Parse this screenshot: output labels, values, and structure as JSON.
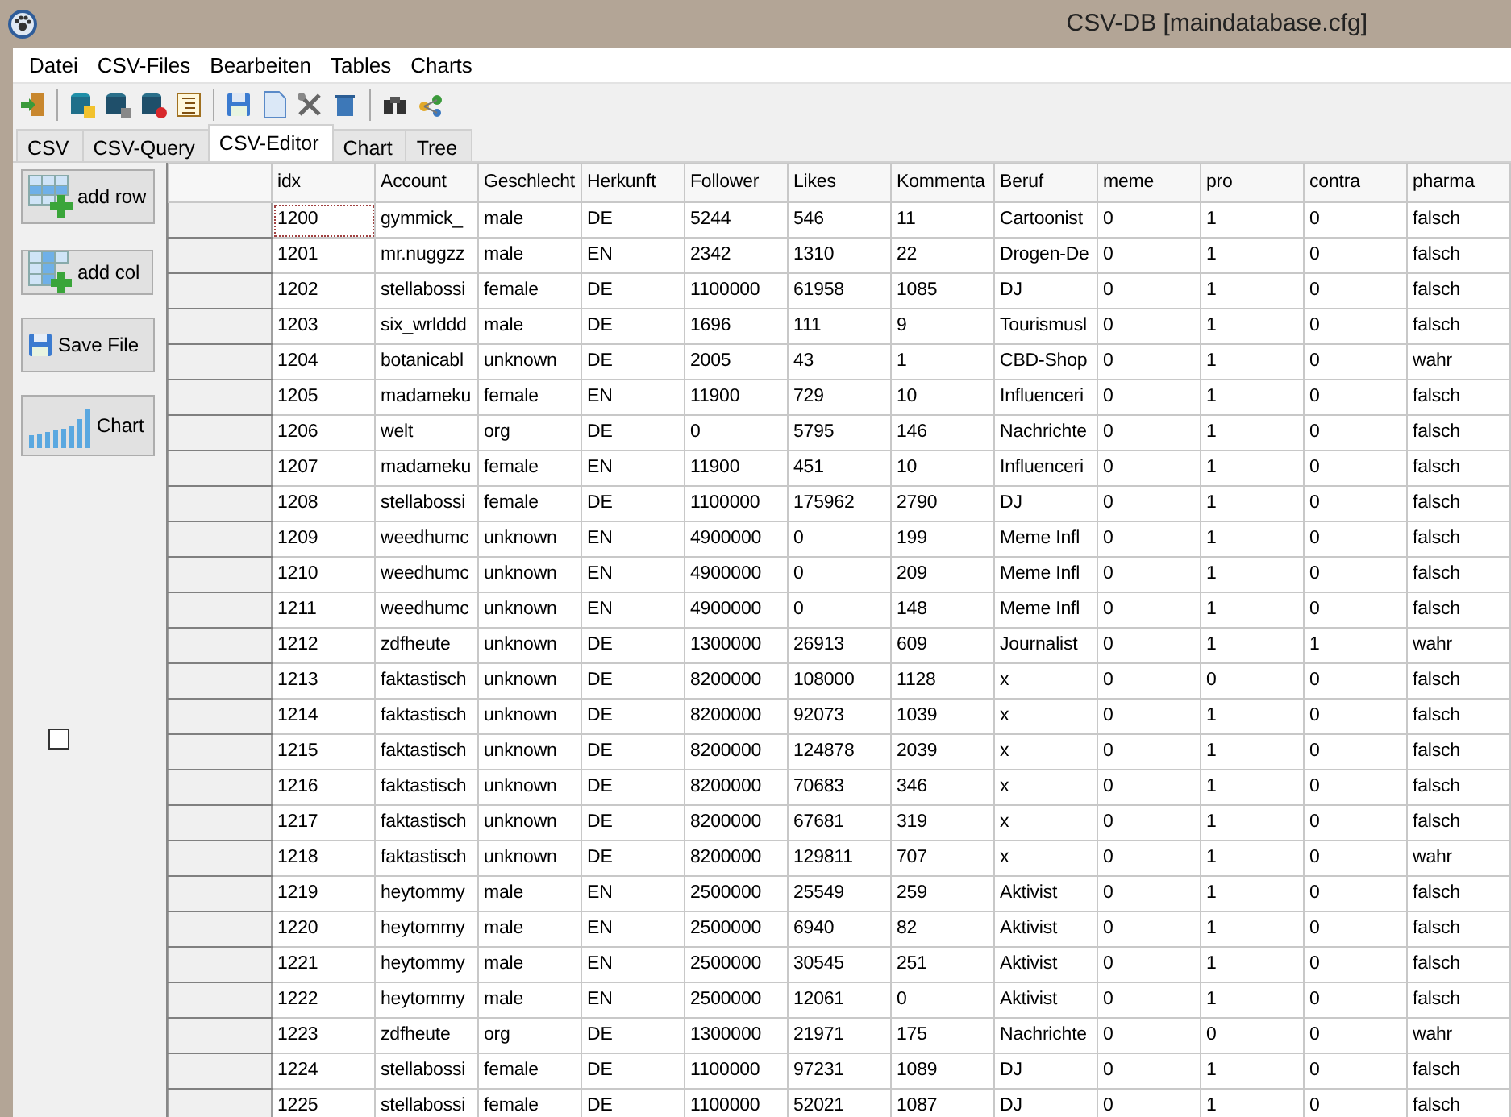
{
  "window": {
    "title": "CSV-DB [maindatabase.cfg]"
  },
  "menu": [
    "Datei",
    "CSV-Files",
    "Bearbeiten",
    "Tables",
    "Charts"
  ],
  "tabs": [
    {
      "label": "CSV",
      "selected": false
    },
    {
      "label": "CSV-Query",
      "selected": false
    },
    {
      "label": "CSV-Editor",
      "selected": true
    },
    {
      "label": "Chart",
      "selected": false
    },
    {
      "label": "Tree",
      "selected": false
    }
  ],
  "side_buttons": [
    {
      "label": "add row",
      "kind": "addrow"
    },
    {
      "label": "add col",
      "kind": "addcol"
    },
    {
      "label": "Save File",
      "kind": "save"
    },
    {
      "label": "Chart",
      "kind": "chart"
    }
  ],
  "checkbox": {
    "checked": false
  },
  "table": {
    "columns": [
      "idx",
      "Account",
      "Geschlecht",
      "Herkunft",
      "Follower",
      "Likes",
      "Kommenta",
      "Beruf",
      "meme",
      "pro",
      "contra",
      "pharma"
    ],
    "rows": [
      {
        "focused": true,
        "cells": [
          "1200",
          "gymmick_",
          "male",
          "DE",
          "5244",
          "546",
          "11",
          "Cartoonist",
          "0",
          "1",
          "0",
          "falsch"
        ]
      },
      {
        "focused": false,
        "cells": [
          "1201",
          "mr.nuggzz",
          "male",
          "EN",
          "2342",
          "1310",
          "22",
          "Drogen-De",
          "0",
          "1",
          "0",
          "falsch"
        ]
      },
      {
        "focused": false,
        "cells": [
          "1202",
          "stellabossi",
          "female",
          "DE",
          "1100000",
          "61958",
          "1085",
          "DJ",
          "0",
          "1",
          "0",
          "falsch"
        ]
      },
      {
        "focused": false,
        "cells": [
          "1203",
          "six_wrlddd",
          "male",
          "DE",
          "1696",
          "111",
          "9",
          "Tourismusl",
          "0",
          "1",
          "0",
          "falsch"
        ]
      },
      {
        "focused": false,
        "cells": [
          "1204",
          "botanicabl",
          "unknown",
          "DE",
          "2005",
          "43",
          "1",
          "CBD-Shop",
          "0",
          "1",
          "0",
          "wahr"
        ]
      },
      {
        "focused": false,
        "cells": [
          "1205",
          "madameku",
          "female",
          "EN",
          "11900",
          "729",
          "10",
          "Influenceri",
          "0",
          "1",
          "0",
          "falsch"
        ]
      },
      {
        "focused": false,
        "cells": [
          "1206",
          "welt",
          "org",
          "DE",
          "0",
          "5795",
          "146",
          "Nachrichte",
          "0",
          "1",
          "0",
          "falsch"
        ]
      },
      {
        "focused": false,
        "cells": [
          "1207",
          "madameku",
          "female",
          "EN",
          "11900",
          "451",
          "10",
          "Influenceri",
          "0",
          "1",
          "0",
          "falsch"
        ]
      },
      {
        "focused": false,
        "cells": [
          "1208",
          "stellabossi",
          "female",
          "DE",
          "1100000",
          "175962",
          "2790",
          "DJ",
          "0",
          "1",
          "0",
          "falsch"
        ]
      },
      {
        "focused": false,
        "cells": [
          "1209",
          "weedhumc",
          "unknown",
          "EN",
          "4900000",
          "0",
          "199",
          "Meme Infl",
          "0",
          "1",
          "0",
          "falsch"
        ]
      },
      {
        "focused": false,
        "cells": [
          "1210",
          "weedhumc",
          "unknown",
          "EN",
          "4900000",
          "0",
          "209",
          "Meme Infl",
          "0",
          "1",
          "0",
          "falsch"
        ]
      },
      {
        "focused": false,
        "cells": [
          "1211",
          "weedhumc",
          "unknown",
          "EN",
          "4900000",
          "0",
          "148",
          "Meme Infl",
          "0",
          "1",
          "0",
          "falsch"
        ]
      },
      {
        "focused": false,
        "cells": [
          "1212",
          "zdfheute",
          "unknown",
          "DE",
          "1300000",
          "26913",
          "609",
          "Journalist",
          "0",
          "1",
          "1",
          "wahr"
        ]
      },
      {
        "focused": false,
        "cells": [
          "1213",
          "faktastisch",
          "unknown",
          "DE",
          "8200000",
          "108000",
          "1128",
          "x",
          "0",
          "0",
          "0",
          "falsch"
        ]
      },
      {
        "focused": false,
        "cells": [
          "1214",
          "faktastisch",
          "unknown",
          "DE",
          "8200000",
          "92073",
          "1039",
          "x",
          "0",
          "1",
          "0",
          "falsch"
        ]
      },
      {
        "focused": false,
        "cells": [
          "1215",
          "faktastisch",
          "unknown",
          "DE",
          "8200000",
          "124878",
          "2039",
          "x",
          "0",
          "1",
          "0",
          "falsch"
        ]
      },
      {
        "focused": false,
        "cells": [
          "1216",
          "faktastisch",
          "unknown",
          "DE",
          "8200000",
          "70683",
          "346",
          "x",
          "0",
          "1",
          "0",
          "falsch"
        ]
      },
      {
        "focused": false,
        "cells": [
          "1217",
          "faktastisch",
          "unknown",
          "DE",
          "8200000",
          "67681",
          "319",
          "x",
          "0",
          "1",
          "0",
          "falsch"
        ]
      },
      {
        "focused": false,
        "cells": [
          "1218",
          "faktastisch",
          "unknown",
          "DE",
          "8200000",
          "129811",
          "707",
          "x",
          "0",
          "1",
          "0",
          "wahr"
        ]
      },
      {
        "focused": false,
        "cells": [
          "1219",
          "heytommy",
          "male",
          "EN",
          "2500000",
          "25549",
          "259",
          "Aktivist",
          "0",
          "1",
          "0",
          "falsch"
        ]
      },
      {
        "focused": false,
        "cells": [
          "1220",
          "heytommy",
          "male",
          "EN",
          "2500000",
          "6940",
          "82",
          "Aktivist",
          "0",
          "1",
          "0",
          "falsch"
        ]
      },
      {
        "focused": false,
        "cells": [
          "1221",
          "heytommy",
          "male",
          "EN",
          "2500000",
          "30545",
          "251",
          "Aktivist",
          "0",
          "1",
          "0",
          "falsch"
        ]
      },
      {
        "focused": false,
        "cells": [
          "1222",
          "heytommy",
          "male",
          "EN",
          "2500000",
          "12061",
          "0",
          "Aktivist",
          "0",
          "1",
          "0",
          "falsch"
        ]
      },
      {
        "focused": false,
        "cells": [
          "1223",
          "zdfheute",
          "org",
          "DE",
          "1300000",
          "21971",
          "175",
          "Nachrichte",
          "0",
          "0",
          "0",
          "wahr"
        ]
      },
      {
        "focused": false,
        "cells": [
          "1224",
          "stellabossi",
          "female",
          "DE",
          "1100000",
          "97231",
          "1089",
          "DJ",
          "0",
          "1",
          "0",
          "falsch"
        ]
      },
      {
        "focused": false,
        "cells": [
          "1225",
          "stellabossi",
          "female",
          "DE",
          "1100000",
          "52021",
          "1087",
          "DJ",
          "0",
          "1",
          "0",
          "falsch"
        ]
      }
    ]
  }
}
